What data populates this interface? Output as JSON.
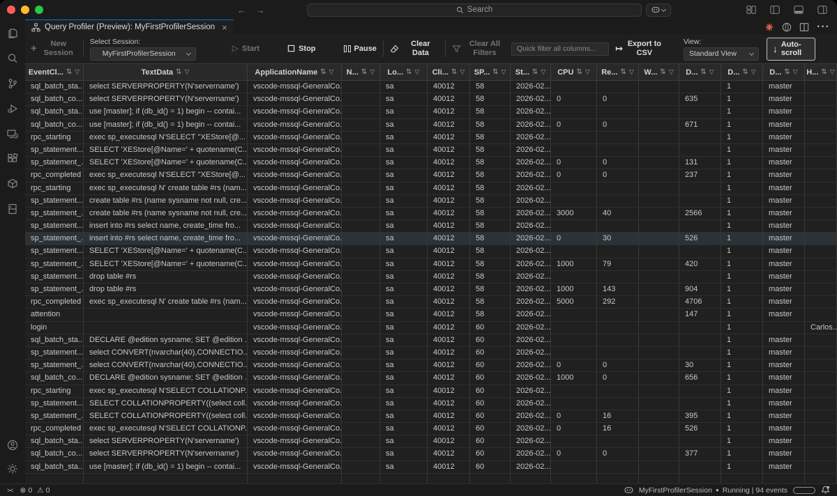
{
  "title_bar": {
    "search_placeholder": "Search"
  },
  "tab": {
    "title": "Query Profiler (Preview): MyFirstProfilerSession",
    "close_glyph": "×"
  },
  "icons": {
    "back": "←",
    "forward": "→",
    "plus": "+",
    "start": "▷",
    "export": "↦",
    "autoscroll_arrow": "↓",
    "sort": "⇅",
    "filter": "▽",
    "ellipsis": "···",
    "error": "⊗",
    "warning": "⚠",
    "running_dot": "●",
    "remote": "><",
    "search": "⌕"
  },
  "toolbar": {
    "new_session": "New Session",
    "select_session_label": "Select Session:",
    "session_value": "MyFirstProfilerSession",
    "start": "Start",
    "stop": "Stop",
    "pause": "Pause",
    "clear_data": "Clear Data",
    "clear_all_filters": "Clear All Filters",
    "quick_filter_placeholder": "Quick filter all columns...",
    "export_csv": "Export to CSV",
    "view_label": "View:",
    "view_value": "Standard View",
    "auto_scroll": "Auto-scroll"
  },
  "grid": {
    "columns": [
      "EventCl...",
      "TextData",
      "ApplicationName",
      "N...",
      "Lo...",
      "Cli...",
      "SP...",
      "St...",
      "CPU",
      "Re...",
      "W...",
      "D...",
      "D...",
      "D...",
      "H..."
    ],
    "highlighted_row": 12,
    "rows": [
      [
        "sql_batch_sta...",
        "select SERVERPROPERTY(N'servername')",
        "vscode-mssql-GeneralCo...",
        "",
        "sa",
        "40012",
        "58",
        "2026-02...",
        "",
        "",
        "",
        "",
        "1",
        "master",
        ""
      ],
      [
        "sql_batch_co...",
        "select SERVERPROPERTY(N'servername')",
        "vscode-mssql-GeneralCo...",
        "",
        "sa",
        "40012",
        "58",
        "2026-02...",
        "0",
        "0",
        "",
        "635",
        "1",
        "master",
        ""
      ],
      [
        "sql_batch_sta...",
        "use [master]; if (db_id() = 1) begin -- contai...",
        "vscode-mssql-GeneralCo...",
        "",
        "sa",
        "40012",
        "58",
        "2026-02...",
        "",
        "",
        "",
        "",
        "1",
        "master",
        ""
      ],
      [
        "sql_batch_co...",
        "use [master]; if (db_id() = 1) begin -- contai...",
        "vscode-mssql-GeneralCo...",
        "",
        "sa",
        "40012",
        "58",
        "2026-02...",
        "0",
        "0",
        "",
        "671",
        "1",
        "master",
        ""
      ],
      [
        "rpc_starting",
        "exec sp_executesql N'SELECT ''XEStore[@...",
        "vscode-mssql-GeneralCo...",
        "",
        "sa",
        "40012",
        "58",
        "2026-02...",
        "",
        "",
        "",
        "",
        "1",
        "master",
        ""
      ],
      [
        "sp_statement...",
        "SELECT 'XEStore[@Name=' + quotename(C...",
        "vscode-mssql-GeneralCo...",
        "",
        "sa",
        "40012",
        "58",
        "2026-02...",
        "",
        "",
        "",
        "",
        "1",
        "master",
        ""
      ],
      [
        "sp_statement_...",
        "SELECT 'XEStore[@Name=' + quotename(C...",
        "vscode-mssql-GeneralCo...",
        "",
        "sa",
        "40012",
        "58",
        "2026-02...",
        "0",
        "0",
        "",
        "131",
        "1",
        "master",
        ""
      ],
      [
        "rpc_completed",
        "exec sp_executesql N'SELECT ''XEStore[@...",
        "vscode-mssql-GeneralCo...",
        "",
        "sa",
        "40012",
        "58",
        "2026-02...",
        "0",
        "0",
        "",
        "237",
        "1",
        "master",
        ""
      ],
      [
        "rpc_starting",
        "exec sp_executesql N' create table #rs (nam...",
        "vscode-mssql-GeneralCo...",
        "",
        "sa",
        "40012",
        "58",
        "2026-02...",
        "",
        "",
        "",
        "",
        "1",
        "master",
        ""
      ],
      [
        "sp_statement...",
        "create table #rs (name sysname not null, cre...",
        "vscode-mssql-GeneralCo...",
        "",
        "sa",
        "40012",
        "58",
        "2026-02...",
        "",
        "",
        "",
        "",
        "1",
        "master",
        ""
      ],
      [
        "sp_statement_...",
        "create table #rs (name sysname not null, cre...",
        "vscode-mssql-GeneralCo...",
        "",
        "sa",
        "40012",
        "58",
        "2026-02...",
        "3000",
        "40",
        "",
        "2566",
        "1",
        "master",
        ""
      ],
      [
        "sp_statement...",
        "insert into #rs select name, create_time fro...",
        "vscode-mssql-GeneralCo...",
        "",
        "sa",
        "40012",
        "58",
        "2026-02...",
        "",
        "",
        "",
        "",
        "1",
        "master",
        ""
      ],
      [
        "sp_statement_...",
        "insert into #rs select name, create_time fro...",
        "vscode-mssql-GeneralCo...",
        "",
        "sa",
        "40012",
        "58",
        "2026-02...",
        "0",
        "30",
        "",
        "526",
        "1",
        "master",
        ""
      ],
      [
        "sp_statement...",
        "SELECT 'XEStore[@Name=' + quotename(C...",
        "vscode-mssql-GeneralCo...",
        "",
        "sa",
        "40012",
        "58",
        "2026-02...",
        "",
        "",
        "",
        "",
        "1",
        "master",
        ""
      ],
      [
        "sp_statement_...",
        "SELECT 'XEStore[@Name=' + quotename(C...",
        "vscode-mssql-GeneralCo...",
        "",
        "sa",
        "40012",
        "58",
        "2026-02...",
        "1000",
        "79",
        "",
        "420",
        "1",
        "master",
        ""
      ],
      [
        "sp_statement...",
        "drop table #rs",
        "vscode-mssql-GeneralCo...",
        "",
        "sa",
        "40012",
        "58",
        "2026-02...",
        "",
        "",
        "",
        "",
        "1",
        "master",
        ""
      ],
      [
        "sp_statement_...",
        "drop table #rs",
        "vscode-mssql-GeneralCo...",
        "",
        "sa",
        "40012",
        "58",
        "2026-02...",
        "1000",
        "143",
        "",
        "904",
        "1",
        "master",
        ""
      ],
      [
        "rpc_completed",
        "exec sp_executesql N' create table #rs (nam...",
        "vscode-mssql-GeneralCo...",
        "",
        "sa",
        "40012",
        "58",
        "2026-02...",
        "5000",
        "292",
        "",
        "4706",
        "1",
        "master",
        ""
      ],
      [
        "attention",
        "",
        "vscode-mssql-GeneralCo...",
        "",
        "sa",
        "40012",
        "58",
        "2026-02...",
        "",
        "",
        "",
        "147",
        "1",
        "master",
        ""
      ],
      [
        "login",
        "",
        "vscode-mssql-GeneralCo...",
        "",
        "sa",
        "40012",
        "60",
        "2026-02...",
        "",
        "",
        "",
        "",
        "1",
        "",
        "Carlos..."
      ],
      [
        "sql_batch_sta...",
        "DECLARE @edition sysname; SET @edition ...",
        "vscode-mssql-GeneralCo...",
        "",
        "sa",
        "40012",
        "60",
        "2026-02...",
        "",
        "",
        "",
        "",
        "1",
        "master",
        ""
      ],
      [
        "sp_statement...",
        "select CONVERT(nvarchar(40),CONNECTIO...",
        "vscode-mssql-GeneralCo...",
        "",
        "sa",
        "40012",
        "60",
        "2026-02...",
        "",
        "",
        "",
        "",
        "1",
        "master",
        ""
      ],
      [
        "sp_statement_...",
        "select CONVERT(nvarchar(40),CONNECTIO...",
        "vscode-mssql-GeneralCo...",
        "",
        "sa",
        "40012",
        "60",
        "2026-02...",
        "0",
        "0",
        "",
        "30",
        "1",
        "master",
        ""
      ],
      [
        "sql_batch_co...",
        "DECLARE @edition sysname; SET @edition ...",
        "vscode-mssql-GeneralCo...",
        "",
        "sa",
        "40012",
        "60",
        "2026-02...",
        "1000",
        "0",
        "",
        "656",
        "1",
        "master",
        ""
      ],
      [
        "rpc_starting",
        "exec sp_executesql N'SELECT COLLATIONP...",
        "vscode-mssql-GeneralCo...",
        "",
        "sa",
        "40012",
        "60",
        "2026-02...",
        "",
        "",
        "",
        "",
        "1",
        "master",
        ""
      ],
      [
        "sp_statement...",
        "SELECT COLLATIONPROPERTY((select coll...",
        "vscode-mssql-GeneralCo...",
        "",
        "sa",
        "40012",
        "60",
        "2026-02...",
        "",
        "",
        "",
        "",
        "1",
        "master",
        ""
      ],
      [
        "sp_statement_...",
        "SELECT COLLATIONPROPERTY((select coll...",
        "vscode-mssql-GeneralCo...",
        "",
        "sa",
        "40012",
        "60",
        "2026-02...",
        "0",
        "16",
        "",
        "395",
        "1",
        "master",
        ""
      ],
      [
        "rpc_completed",
        "exec sp_executesql N'SELECT COLLATIONP...",
        "vscode-mssql-GeneralCo...",
        "",
        "sa",
        "40012",
        "60",
        "2026-02...",
        "0",
        "16",
        "",
        "526",
        "1",
        "master",
        ""
      ],
      [
        "sql_batch_sta...",
        "select SERVERPROPERTY(N'servername')",
        "vscode-mssql-GeneralCo...",
        "",
        "sa",
        "40012",
        "60",
        "2026-02...",
        "",
        "",
        "",
        "",
        "1",
        "master",
        ""
      ],
      [
        "sql_batch_co...",
        "select SERVERPROPERTY(N'servername')",
        "vscode-mssql-GeneralCo...",
        "",
        "sa",
        "40012",
        "60",
        "2026-02...",
        "0",
        "0",
        "",
        "377",
        "1",
        "master",
        ""
      ],
      [
        "sql_batch_sta...",
        "use [master]; if (db_id() = 1) begin -- contai...",
        "vscode-mssql-GeneralCo...",
        "",
        "sa",
        "40012",
        "60",
        "2026-02...",
        "",
        "",
        "",
        "",
        "1",
        "master",
        ""
      ]
    ]
  },
  "status_bar": {
    "errors": "0",
    "warnings": "0",
    "session_name": "MyFirstProfilerSession",
    "running_status": "Running | 94 events"
  }
}
